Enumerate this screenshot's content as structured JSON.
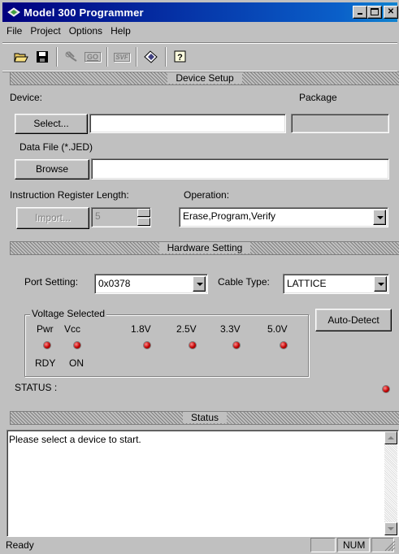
{
  "window": {
    "title": "Model 300 Programmer"
  },
  "menu": [
    "File",
    "Project",
    "Options",
    "Help"
  ],
  "toolbar": {
    "buttons": [
      "open-folder-icon",
      "save-disk-icon",
      "scan-icon",
      "go-icon",
      "svf-icon",
      "program-icon",
      "help-icon"
    ],
    "go_label": "GO",
    "svf_label": "SVF"
  },
  "device_setup": {
    "header": "Device Setup",
    "device_label": "Device:",
    "package_label": "Package",
    "select_button": "Select...",
    "device_value": "",
    "package_value": "",
    "data_file_label": "Data File (*.JED)",
    "browse_button": "Browse",
    "data_file_value": "",
    "ir_length_label": "Instruction Register Length:",
    "import_button": "Import...",
    "ir_length_value": "5",
    "operation_label": "Operation:",
    "operation_value": "Erase,Program,Verify"
  },
  "hardware": {
    "header": "Hardware Setting",
    "port_label": "Port Setting:",
    "port_value": "0x0378",
    "cable_label": "Cable Type:",
    "cable_value": "LATTICE",
    "voltage_legend": "Voltage Selected",
    "pwr_label": "Pwr",
    "vcc_label": "Vcc",
    "volt_labels": [
      "1.8V",
      "2.5V",
      "3.3V",
      "5.0V"
    ],
    "rdy_label": "RDY",
    "on_label": "ON",
    "auto_detect_button": "Auto-Detect",
    "status_label": "STATUS :",
    "led_color": "#c00000"
  },
  "status": {
    "header": "Status",
    "message": "Please select a device to start."
  },
  "statusbar": {
    "text": "Ready",
    "num": "NUM"
  }
}
